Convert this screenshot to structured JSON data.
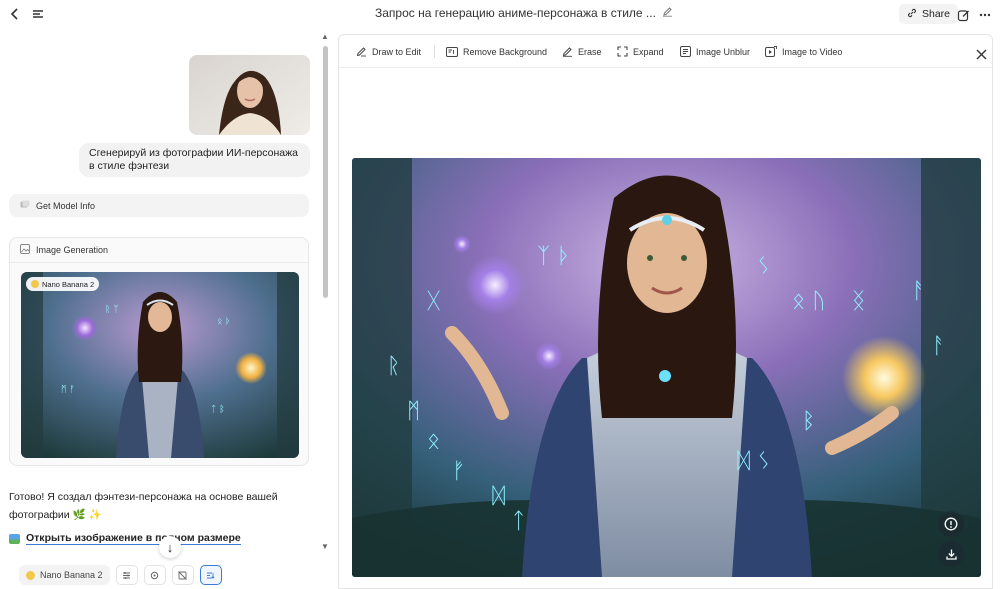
{
  "header": {
    "title": "Запрос на генерацию аниме-персонажа в стиле ...",
    "share_label": "Share"
  },
  "chat": {
    "user_message": "Сгенерируй из фотографии ИИ-персонажа в стиле фэнтези",
    "tool_call_label": "Get Model Info",
    "image_card_title": "Image Generation",
    "image_badge": "Nano Banana 2",
    "reply_line1": "Готово! Я создал фэнтези-персонажа на основе вашей",
    "reply_line2": "фотографии 🌿 ✨",
    "open_link": "Открыть изображение в полном размере",
    "model_selector": "Nano Banana 2"
  },
  "viewer": {
    "tools": [
      "Draw to Edit",
      "Remove Background",
      "Erase",
      "Expand",
      "Image Unblur",
      "Image to Video"
    ]
  },
  "colors": {
    "accent": "#3a7bd5",
    "pill_bg": "#f3f3f3"
  }
}
